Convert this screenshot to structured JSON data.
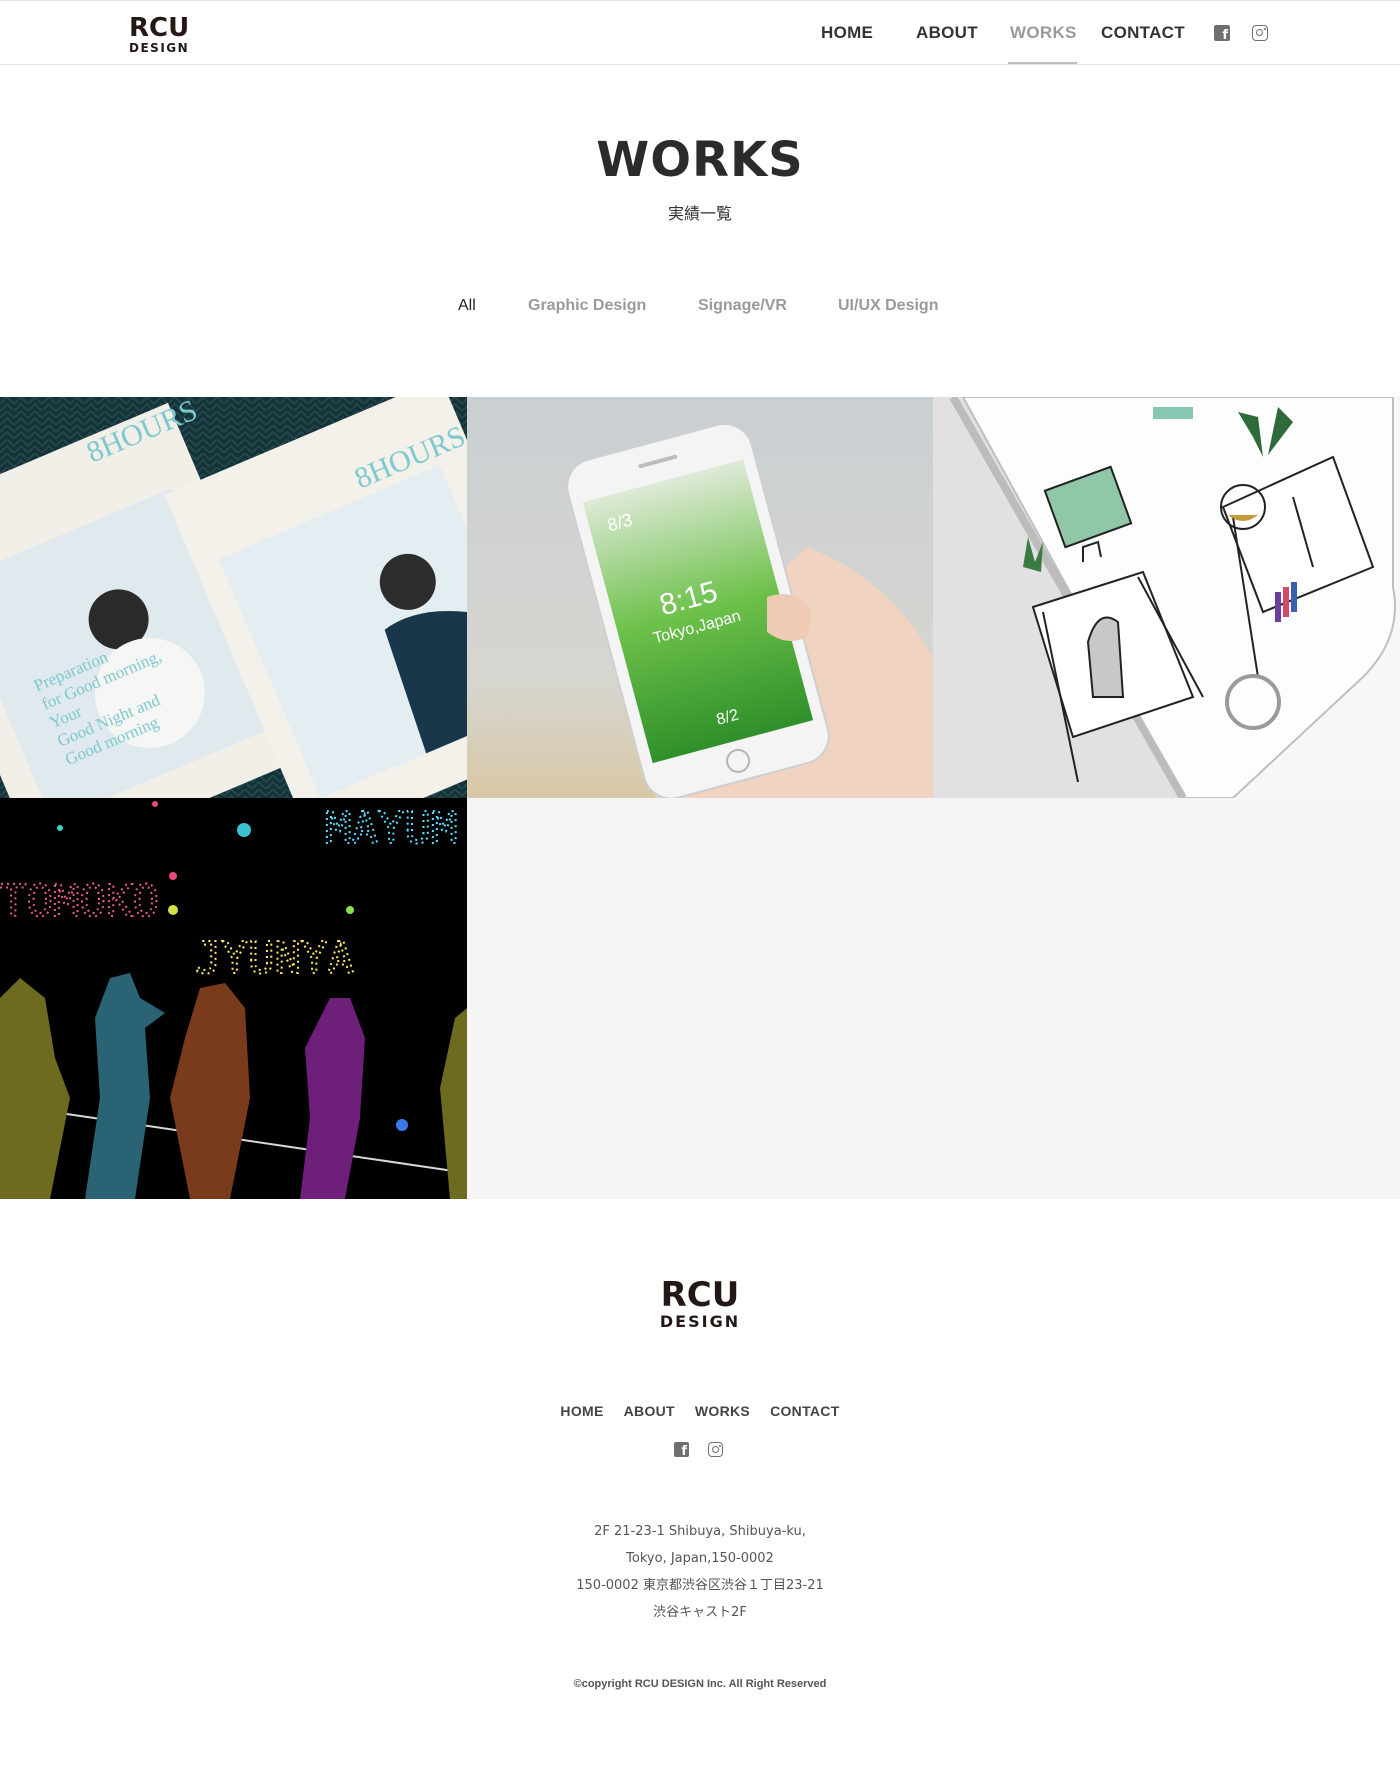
{
  "header": {
    "logo_line1": "RCU",
    "logo_line2": "DESIGN",
    "nav": [
      {
        "label": "HOME"
      },
      {
        "label": "ABOUT"
      },
      {
        "label": "WORKS",
        "active": true
      },
      {
        "label": "CONTACT"
      }
    ],
    "social": [
      "facebook-icon",
      "instagram-icon"
    ]
  },
  "page": {
    "title": "WORKS",
    "subtitle": "実績一覧"
  },
  "filters": [
    {
      "label": "All",
      "active": true
    },
    {
      "label": "Graphic Design"
    },
    {
      "label": "Signage/VR"
    },
    {
      "label": "UI/UX Design"
    }
  ],
  "works": {
    "tile1": {
      "title": "8HOURS",
      "text1": "Preparation",
      "text2": "for Good morning,",
      "text3": "Your",
      "text4": "Good Night and",
      "text5": "Good morning"
    },
    "tile2": {
      "date": "8/3",
      "time": "8:15",
      "place": "Tokyo,Japan",
      "bottom": "8/2"
    },
    "tile4": {
      "name1": "TOMOKO",
      "name2": "JYUNYA",
      "name3": "MAYUM"
    }
  },
  "footer": {
    "logo_line1": "RCU",
    "logo_line2": "DESIGN",
    "nav": [
      {
        "label": "HOME"
      },
      {
        "label": "ABOUT"
      },
      {
        "label": "WORKS"
      },
      {
        "label": "CONTACT"
      }
    ],
    "address": [
      "2F 21-23-1 Shibuya, Shibuya-ku,",
      "Tokyo, Japan,150-0002",
      "150-0002 東京都渋谷区渋谷１丁目23-21",
      "渋谷キャスト2F"
    ],
    "copyright": "©copyright RCU DESIGN Inc. All Right Reserved"
  },
  "colors": {
    "text": "#333333",
    "muted": "#9a9a9a",
    "border": "#e4e4e4",
    "grid_bg": "#f5f5f5"
  }
}
